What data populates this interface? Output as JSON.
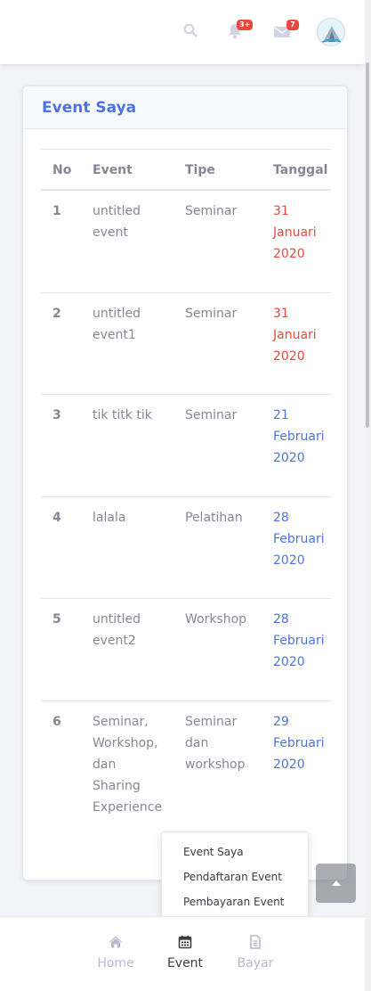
{
  "topbar": {
    "icons": [
      "search-icon",
      "bell-icon",
      "envelope-icon"
    ],
    "alerts_badge": "3+",
    "messages_badge": "7"
  },
  "card": {
    "title": "Event Saya",
    "columns": [
      "No",
      "Event",
      "Tipe",
      "Tanggal"
    ],
    "rows": [
      {
        "no": "1",
        "event": [
          "untitled",
          "event"
        ],
        "tipe": [
          "Seminar"
        ],
        "tanggal": [
          "31",
          "Januari",
          "2020"
        ],
        "color": "#e74a3b"
      },
      {
        "no": "2",
        "event": [
          "untitled",
          "event1"
        ],
        "tipe": [
          "Seminar"
        ],
        "tanggal": [
          "31",
          "Januari",
          "2020"
        ],
        "color": "#e74a3b"
      },
      {
        "no": "3",
        "event": [
          "tik titk tik"
        ],
        "tipe": [
          "Seminar"
        ],
        "tanggal": [
          "21",
          "Februari",
          "2020"
        ],
        "color": "#4e73df"
      },
      {
        "no": "4",
        "event": [
          "lalala"
        ],
        "tipe": [
          "Pelatihan"
        ],
        "tanggal": [
          "28",
          "Februari",
          "2020"
        ],
        "color": "#4e73df"
      },
      {
        "no": "5",
        "event": [
          "untitled",
          "event2"
        ],
        "tipe": [
          "Workshop"
        ],
        "tanggal": [
          "28",
          "Februari",
          "2020"
        ],
        "color": "#4e73df"
      },
      {
        "no": "6",
        "event": [
          "Seminar,",
          "Workshop,",
          "dan",
          "Sharing",
          "Experience"
        ],
        "tipe": [
          "Seminar",
          "dan",
          "workshop"
        ],
        "tanggal": [
          "29",
          "Februari",
          "2020"
        ],
        "color": "#4e73df"
      }
    ]
  },
  "dropdown": {
    "items": [
      "Event Saya",
      "Pendaftaran Event",
      "Pembayaran Event"
    ]
  },
  "bottom_nav": {
    "items": [
      {
        "label": "Home",
        "icon": "home-icon",
        "active": false
      },
      {
        "label": "Event",
        "icon": "calendar-icon",
        "active": true
      },
      {
        "label": "Bayar",
        "icon": "receipt-icon",
        "active": false
      }
    ]
  }
}
